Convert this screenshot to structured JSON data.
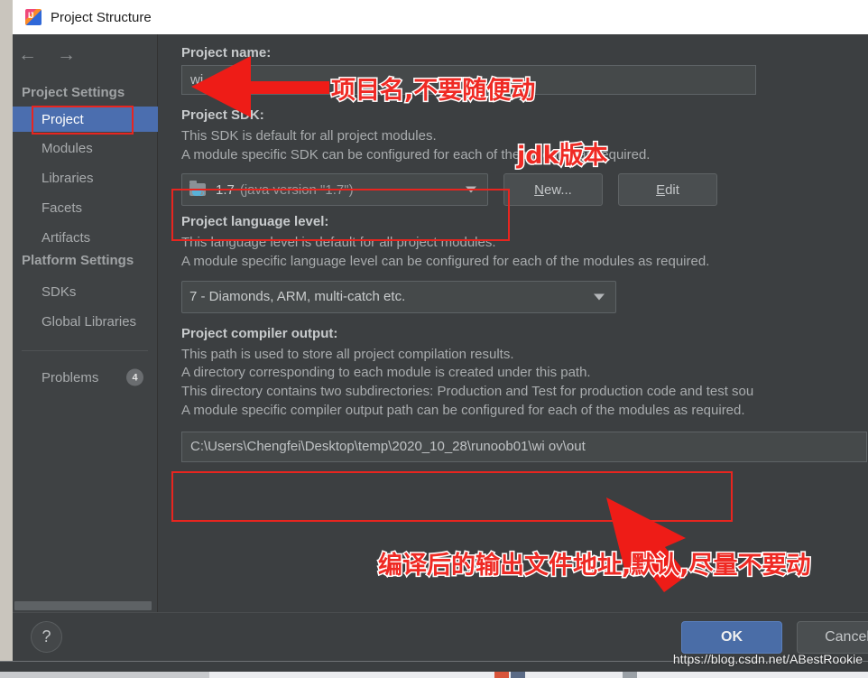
{
  "window": {
    "title": "Project Structure",
    "icon": "intellij-idea-icon"
  },
  "sidebar": {
    "nav": {
      "back": "←",
      "forward": "→"
    },
    "groups": [
      {
        "label": "Project Settings",
        "items": [
          {
            "label": "Project",
            "selected": true
          },
          {
            "label": "Modules",
            "selected": false
          },
          {
            "label": "Libraries",
            "selected": false
          },
          {
            "label": "Facets",
            "selected": false
          },
          {
            "label": "Artifacts",
            "selected": false
          }
        ]
      },
      {
        "label": "Platform Settings",
        "items": [
          {
            "label": "SDKs",
            "selected": false
          },
          {
            "label": "Global Libraries",
            "selected": false
          }
        ]
      }
    ],
    "problems": {
      "label": "Problems",
      "count": "4"
    }
  },
  "main": {
    "project_name": {
      "label": "Project name:",
      "value": "wi.........g..."
    },
    "project_sdk": {
      "label": "Project SDK:",
      "desc_line1": "This SDK is default for all project modules.",
      "desc_line2": "A module specific SDK can be configured for each of the modules as required.",
      "selected_version": "1.7",
      "selected_detail": "(java version \"1.7\")",
      "new_button": "New...",
      "new_button_mnemonic": "N",
      "new_button_rest": "ew...",
      "edit_button": "Edit",
      "edit_button_mnemonic": "E",
      "edit_button_rest": "dit"
    },
    "language_level": {
      "label": "Project language level:",
      "desc_line1": "This language level is default for all project modules.",
      "desc_line2": "A module specific language level can be configured for each of the modules as required.",
      "value": "7 - Diamonds, ARM, multi-catch etc."
    },
    "compiler_output": {
      "label": "Project compiler output:",
      "desc_line1": "This path is used to store all project compilation results.",
      "desc_line2": "A directory corresponding to each module is created under this path.",
      "desc_line3": "This directory contains two subdirectories: Production and Test for production code and test sou",
      "desc_line4": "A module specific compiler output path can be configured for each of the modules as required.",
      "value": "C:\\Users\\Chengfei\\Desktop\\temp\\2020_10_28\\runoob01\\wi        ov\\out"
    }
  },
  "footer": {
    "help": "?",
    "ok": "OK",
    "cancel": "Cancel"
  },
  "watermark": "https://blog.csdn.net/ABestRookie",
  "annotations": {
    "project_name_note": "项目名,不要随便动",
    "sdk_note": "jdk版本",
    "output_note": "编译后的输出文件地址,默认,尽量不要动",
    "highlight_color": "#e8251f",
    "text_color": "#ef2a24"
  }
}
